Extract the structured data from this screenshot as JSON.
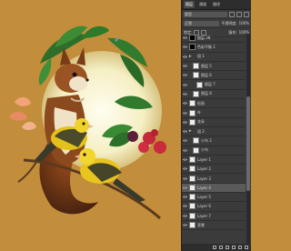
{
  "panel": {
    "tabs": [
      "图层",
      "通道",
      "路径"
    ],
    "active_tab": 0,
    "kind_value": "类型",
    "blend_mode": "正常",
    "opacity_label": "不透明度:",
    "opacity_value": "100%",
    "lock_label": "锁定:",
    "fill_label": "填充:",
    "fill_value": "100%",
    "layers": [
      {
        "name": "图层 28",
        "thumb": "black",
        "indent": 0
      },
      {
        "name": "色彩平衡 1",
        "thumb": "black",
        "indent": 0
      },
      {
        "name": "组 1",
        "thumb": "folder",
        "indent": 0
      },
      {
        "name": "图层 5",
        "thumb": "checker",
        "indent": 1
      },
      {
        "name": "图层 6",
        "thumb": "checker",
        "indent": 1
      },
      {
        "name": "图层 7",
        "thumb": "checker",
        "indent": 2
      },
      {
        "name": "图层 8",
        "thumb": "checker",
        "indent": 1
      },
      {
        "name": "松鼠",
        "thumb": "checker",
        "indent": 0
      },
      {
        "name": "叶",
        "thumb": "checker",
        "indent": 0
      },
      {
        "name": "花朵",
        "thumb": "checker",
        "indent": 0
      },
      {
        "name": "组 2",
        "thumb": "folder",
        "indent": 0
      },
      {
        "name": "小鸟 2",
        "thumb": "checker",
        "indent": 1
      },
      {
        "name": "小鸟",
        "thumb": "checker",
        "indent": 1
      },
      {
        "name": "Layer 1",
        "thumb": "checker",
        "indent": 0
      },
      {
        "name": "Layer 2",
        "thumb": "checker",
        "indent": 0
      },
      {
        "name": "Layer 3",
        "thumb": "checker",
        "indent": 0
      },
      {
        "name": "Layer 4",
        "thumb": "checker",
        "indent": 0,
        "selected": true
      },
      {
        "name": "Layer 5",
        "thumb": "checker",
        "indent": 0
      },
      {
        "name": "Layer 6",
        "thumb": "checker",
        "indent": 0
      },
      {
        "name": "Layer 7",
        "thumb": "checker",
        "indent": 0
      },
      {
        "name": "背景",
        "thumb": "checker",
        "indent": 0
      }
    ]
  },
  "colors": {
    "canvas_bg": "#c28e3b",
    "moon": "#f7f1c6",
    "panel_bg": "#3b3b3b"
  }
}
